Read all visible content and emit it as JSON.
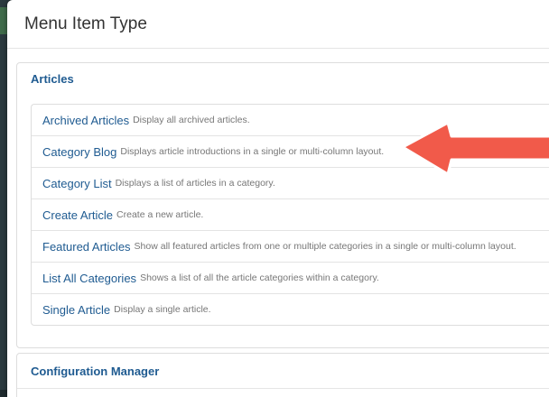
{
  "modal": {
    "title": "Menu Item Type"
  },
  "sections": [
    {
      "heading": "Articles",
      "items": [
        {
          "title": "Archived Articles",
          "description": "Display all archived articles."
        },
        {
          "title": "Category Blog",
          "description": "Displays article introductions in a single or multi-column layout."
        },
        {
          "title": "Category List",
          "description": "Displays a list of articles in a category."
        },
        {
          "title": "Create Article",
          "description": "Create a new article."
        },
        {
          "title": "Featured Articles",
          "description": "Show all featured articles from one or multiple categories in a single or multi-column layout."
        },
        {
          "title": "List All Categories",
          "description": "Shows a list of all the article categories within a category."
        },
        {
          "title": "Single Article",
          "description": "Display a single article."
        }
      ]
    },
    {
      "heading": "Configuration Manager"
    }
  ],
  "annotation": {
    "arrow_color": "#f15a4a",
    "arrow_outline_color": "#ffffff",
    "points_to": "Category Blog"
  },
  "colors": {
    "link": "#1f5b91",
    "description": "#777777",
    "border": "#dddddd"
  }
}
